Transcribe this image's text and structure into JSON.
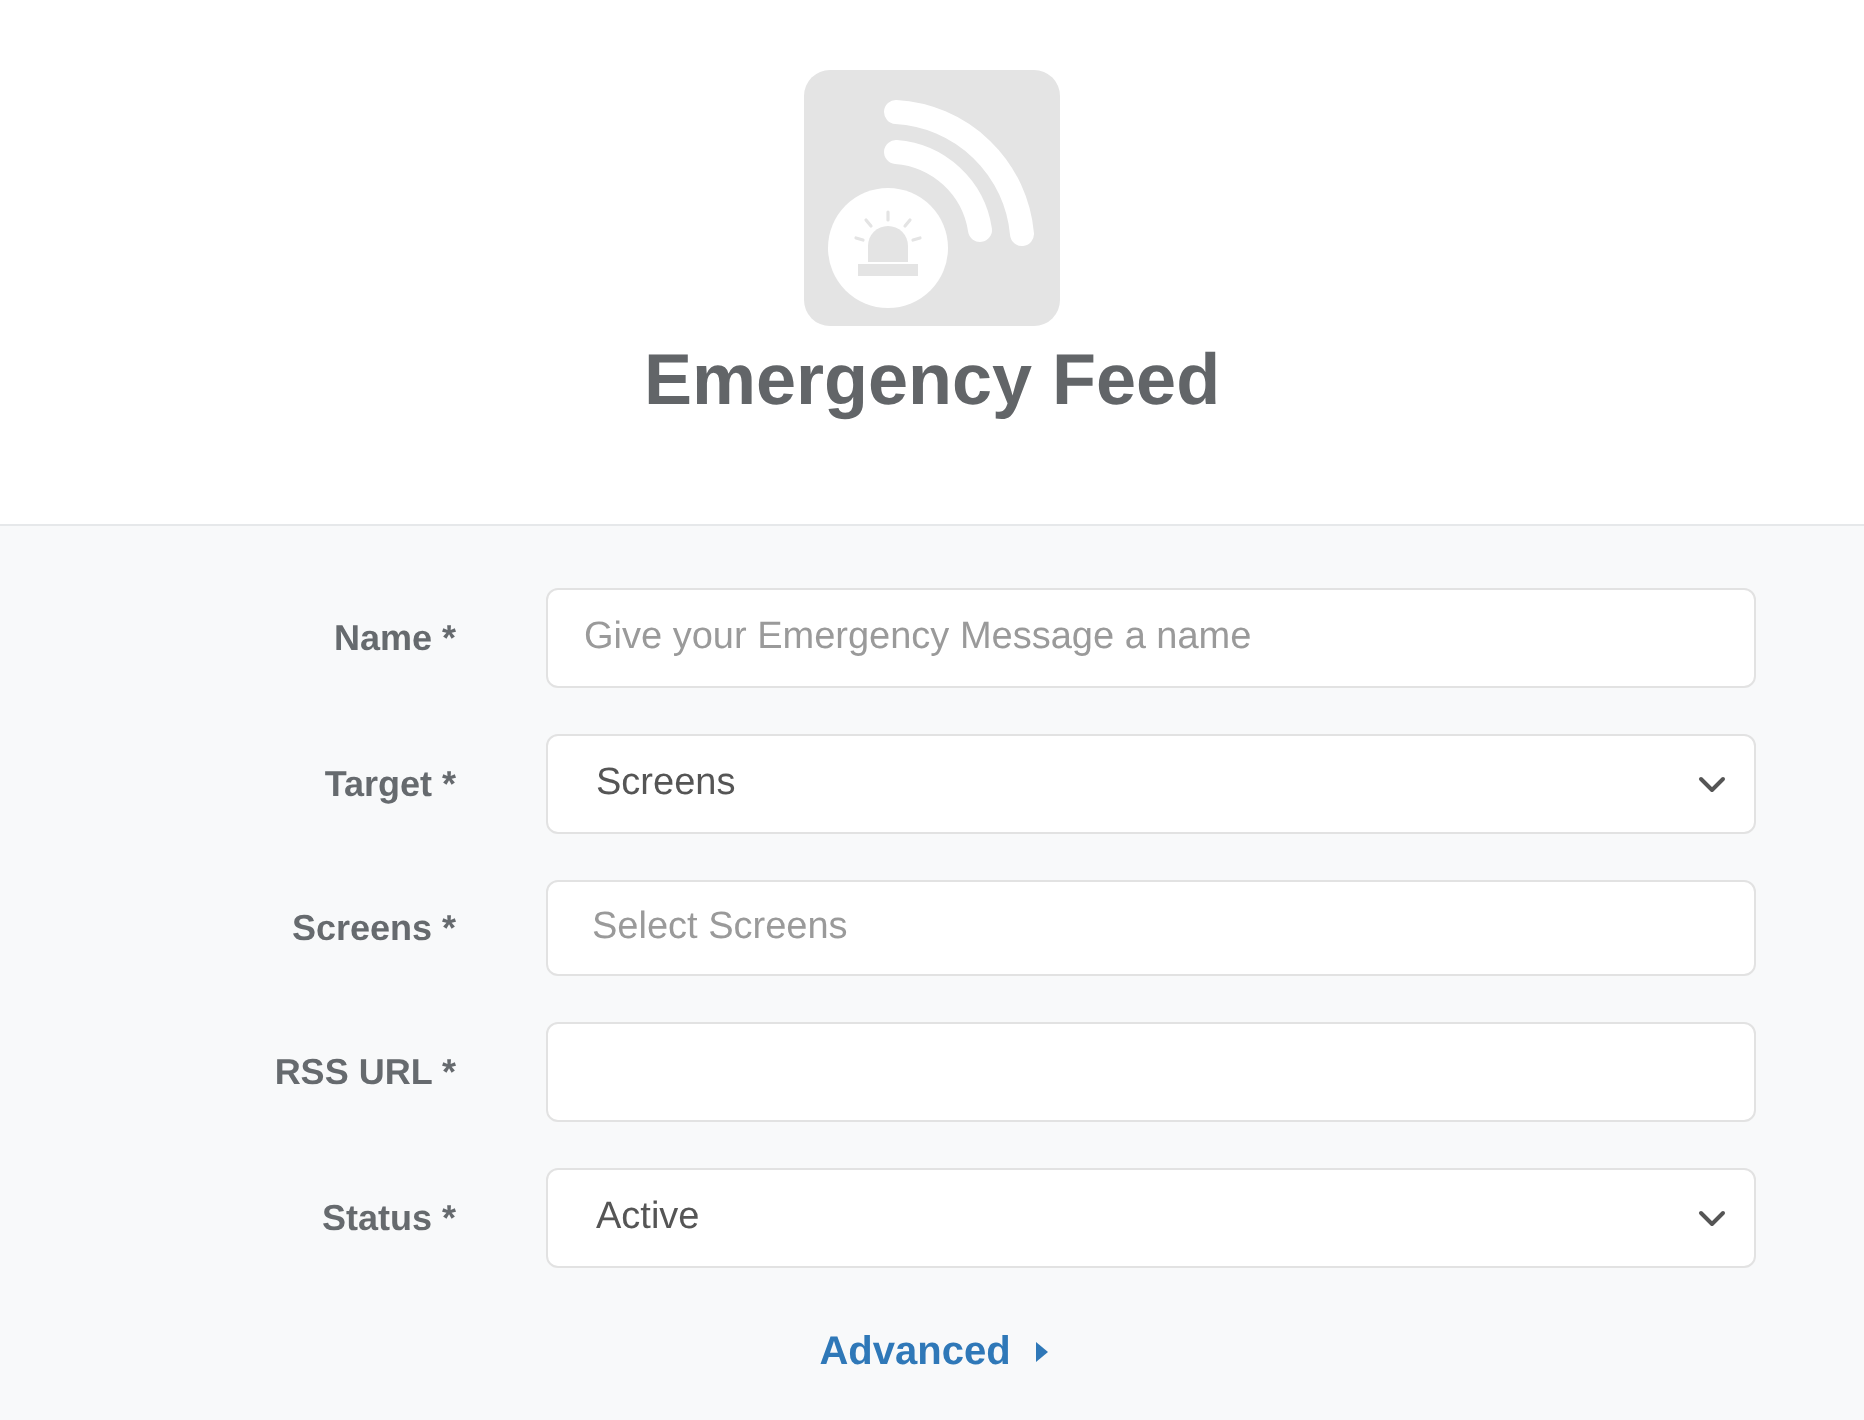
{
  "header": {
    "title": "Emergency Feed"
  },
  "form": {
    "fields": [
      {
        "kind": "text",
        "label": "Name *",
        "placeholder": "Give your Emergency Message a name"
      },
      {
        "kind": "select",
        "label": "Target *",
        "value": "Screens"
      },
      {
        "kind": "multiselect",
        "label": "Screens *",
        "placeholder": "Select Screens"
      },
      {
        "kind": "text",
        "label": "RSS URL *"
      },
      {
        "kind": "select",
        "label": "Status *",
        "value": "Active"
      }
    ],
    "advanced": {
      "label": "Advanced",
      "expanded": false
    }
  }
}
